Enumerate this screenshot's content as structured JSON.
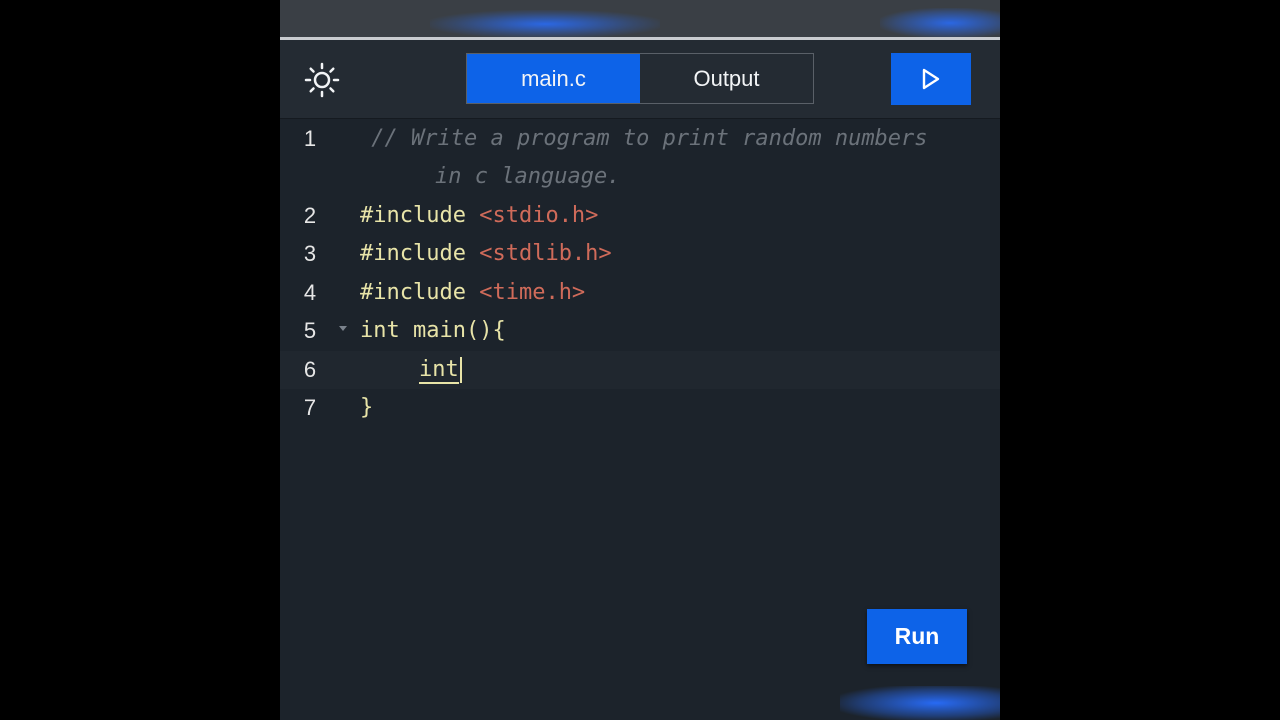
{
  "toolbar": {
    "tabs": [
      {
        "label": "main.c",
        "active": true
      },
      {
        "label": "Output",
        "active": false
      }
    ],
    "theme_icon": "sun-icon",
    "play_icon": "play-icon"
  },
  "editor": {
    "comment_part1": " // Write a program to print random numbers",
    "comment_part2": "in c language.",
    "lines": [
      {
        "number": "1"
      },
      {
        "number": "2",
        "directive": "#include",
        "header": "<stdio.h>"
      },
      {
        "number": "3",
        "directive": "#include",
        "header": "<stdlib.h>"
      },
      {
        "number": "4",
        "directive": "#include",
        "header": "<time.h>"
      },
      {
        "number": "5",
        "code": "int main(){"
      },
      {
        "number": "6",
        "code": "int"
      },
      {
        "number": "7",
        "code": "}"
      }
    ]
  },
  "run_button": {
    "label": "Run"
  },
  "colors": {
    "accent": "#0d63e8",
    "editor_bg": "#1c232b",
    "comment": "#6b727a",
    "keyword": "#e8e4a8",
    "string": "#d06b5a"
  }
}
